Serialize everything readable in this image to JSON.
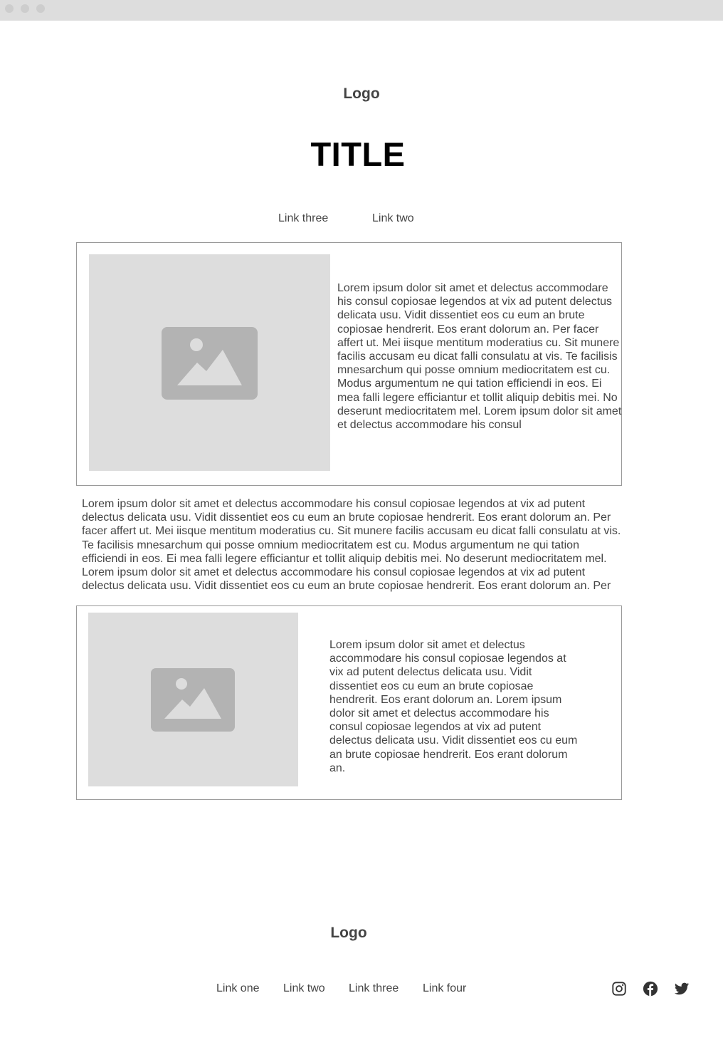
{
  "header": {
    "logo": "Logo",
    "title": "TITLE",
    "nav": [
      "Link three",
      "Link two"
    ]
  },
  "section1": {
    "image_icon": "image-placeholder-icon",
    "text": "Lorem ipsum dolor sit amet et delectus accommodare his consul copiosae legendos at vix ad putent delectus delicata usu. Vidit dissentiet eos cu eum an brute copiosae hendrerit. Eos erant dolorum an. Per facer affert ut. Mei iisque mentitum moderatius cu. Sit munere facilis accusam eu dicat falli consulatu at vis. Te facilisis mnesarchum qui posse omnium mediocritatem est cu. Modus argumentum ne qui tation efficiendi in eos. Ei mea falli legere efficiantur et tollit aliquip debitis mei. No deserunt mediocritatem mel. Lorem ipsum dolor sit amet et delectus accommodare his consul"
  },
  "middle_text": "Lorem ipsum dolor sit amet et delectus accommodare his consul copiosae legendos at vix ad putent delectus delicata usu. Vidit dissentiet eos cu eum an brute copiosae hendrerit. Eos erant dolorum an. Per facer affert ut. Mei iisque mentitum moderatius cu. Sit munere facilis accusam eu dicat falli consulatu at vis. Te facilisis mnesarchum qui posse omnium mediocritatem est cu. Modus argumentum ne qui tation efficiendi in eos. Ei mea falli legere efficiantur et tollit aliquip debitis mei. No deserunt mediocritatem mel. Lorem ipsum dolor sit amet et delectus accommodare his consul copiosae legendos at vix ad putent delectus delicata usu. Vidit dissentiet eos cu eum an brute copiosae hendrerit. Eos erant dolorum an. Per",
  "section2": {
    "image_icon": "image-placeholder-icon",
    "text": "Lorem ipsum dolor sit amet et delectus accommodare his consul copiosae legendos at vix ad putent delectus delicata usu. Vidit dissentiet eos cu eum an brute copiosae hendrerit. Eos erant dolorum an. Lorem ipsum dolor sit amet et delectus accommodare his consul copiosae legendos at vix ad putent delectus delicata usu. Vidit dissentiet eos cu eum an brute copiosae hendrerit. Eos erant dolorum an."
  },
  "footer": {
    "logo": "Logo",
    "links": [
      "Link one",
      "Link two",
      "Link three",
      "Link four"
    ],
    "social": [
      "instagram-icon",
      "facebook-icon",
      "twitter-icon"
    ]
  },
  "colors": {
    "placeholder_bg": "#dddddd",
    "placeholder_icon": "#b3b3b3",
    "border": "#999999",
    "text": "#444444"
  }
}
